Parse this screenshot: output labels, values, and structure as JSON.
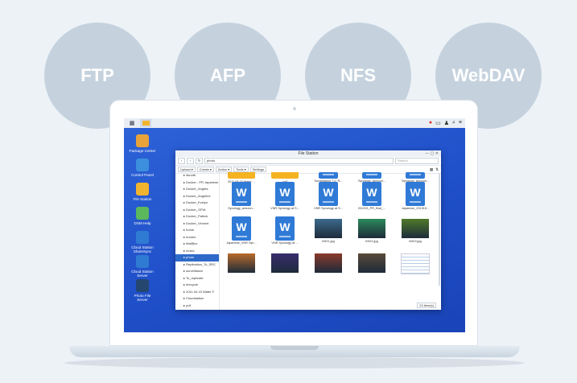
{
  "protocols": [
    "FTP",
    "AFP",
    "NFS",
    "WebDAV"
  ],
  "taskbar": {
    "apps_icon": "grid-icon",
    "filestation_icon": "folder-icon"
  },
  "desktop_icons": [
    {
      "label": "Package Center",
      "color": "#e8a23a"
    },
    {
      "label": "Control Panel",
      "color": "#3b8fdc"
    },
    {
      "label": "File Station",
      "color": "#f1b42f"
    },
    {
      "label": "DSM Help",
      "color": "#5cb85c"
    },
    {
      "label": "Cloud Station ShareSync",
      "color": "#2f7bd3"
    },
    {
      "label": "Cloud Station Server",
      "color": "#2f7bd3"
    },
    {
      "label": "Photo File Server",
      "color": "#25466f"
    }
  ],
  "window": {
    "title": "File Station",
    "path": "photo",
    "search_placeholder": "Search",
    "toolbar": [
      "Upload ▾",
      "Create ▾",
      "Action ▾",
      "Tools ▾",
      "Settings"
    ],
    "sidebar": [
      "dsnoth",
      "Docker - PR Japanese",
      "Docker_Angela",
      "Docker_Angeline",
      "Docker_Evelyn",
      "Docker_GPIA",
      "Docker_Patrick",
      "Docker_Vincent",
      "home",
      "homes",
      "MailBox",
      "music",
      "photo",
      "Replication_To_SRC",
      "surveillance",
      "To_replicate",
      "#recycle",
      "2011.04.15 Water F",
      "Cloudstation",
      "pdf",
      "Transactions"
    ],
    "selected_sidebar": "photo",
    "files": [
      {
        "name": "2011.04.15 Water ...",
        "kind": "folder"
      },
      {
        "name": "pdf",
        "kind": "folder"
      },
      {
        "name": "Surveillance 7.0_R...",
        "kind": "doc"
      },
      {
        "name": "Synology_Announ...",
        "kind": "doc"
      },
      {
        "name": "Synology_Announ...",
        "kind": "doc"
      },
      {
        "name": "Synology_announ...",
        "kind": "doc"
      },
      {
        "name": "VNR Synology at S...",
        "kind": "doc"
      },
      {
        "name": "VNR Synology at S...",
        "kind": "doc"
      },
      {
        "name": "201315_PR_final_...",
        "kind": "doc"
      },
      {
        "name": "Japanese_201315...",
        "kind": "doc"
      },
      {
        "name": "Japanese_VNR Syn...",
        "kind": "doc"
      },
      {
        "name": "VNR Synology at ...",
        "kind": "doc"
      },
      {
        "name": "IMG1.jpg",
        "kind": "photo",
        "color": "#3d6b8c"
      },
      {
        "name": "IMG2.jpg",
        "kind": "photo",
        "color": "#2c8a5c"
      },
      {
        "name": "IMG3.jpg",
        "kind": "photo",
        "color": "#4f7a2a"
      },
      {
        "name": "",
        "kind": "photo",
        "color": "#b86a2a"
      },
      {
        "name": "",
        "kind": "photo",
        "color": "#3a2b6e"
      },
      {
        "name": "",
        "kind": "photo",
        "color": "#8a3a2a"
      },
      {
        "name": "",
        "kind": "photo",
        "color": "#5a4a3a"
      },
      {
        "name": "",
        "kind": "note"
      }
    ],
    "status": "23 item(s)"
  }
}
